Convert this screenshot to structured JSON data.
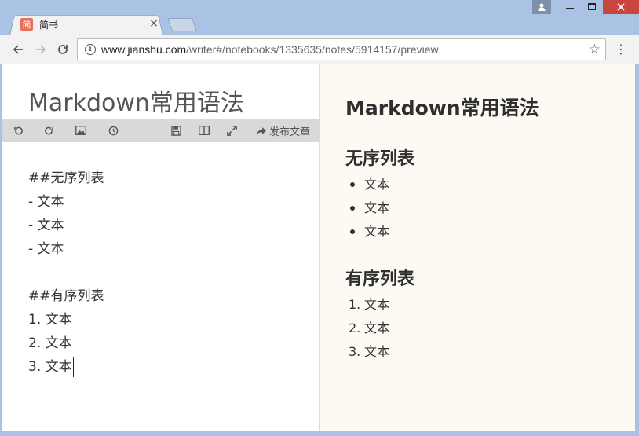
{
  "browser": {
    "tab": {
      "favicon": "简",
      "title": "简书",
      "close": "×"
    },
    "url": {
      "host": "www.jianshu.com",
      "path": "/writer#/notebooks/1335635/notes/5914157/preview"
    },
    "icons": {
      "back": "back-arrow-icon",
      "forward": "forward-arrow-icon",
      "reload": "reload-icon",
      "info": "info-icon",
      "star": "star-icon",
      "menu": "kebab-menu-icon"
    }
  },
  "editor": {
    "title": "Markdown常用语法",
    "toolbar": {
      "undo": "undo-icon",
      "redo": "redo-icon",
      "image": "image-icon",
      "history": "history-clock-icon",
      "save": "save-icon",
      "split": "split-view-icon",
      "fullscreen": "fullscreen-icon",
      "publish_label": "发布文章"
    },
    "lines": [
      "##无序列表",
      "- 文本",
      "- 文本",
      "- 文本",
      "",
      "##有序列表",
      "1. 文本",
      "2. 文本",
      "3. 文本"
    ]
  },
  "preview": {
    "title": "Markdown常用语法",
    "sections": [
      {
        "heading": "无序列表",
        "items": [
          "文本",
          "文本",
          "文本"
        ]
      },
      {
        "heading": "有序列表",
        "items": [
          "文本",
          "文本",
          "文本"
        ],
        "numbers": [
          "1.",
          "2.",
          "3."
        ]
      }
    ]
  },
  "colors": {
    "accent": "#ea6f5a",
    "frame": "#aac3e4",
    "preview_bg": "#fcfaf2",
    "close_button": "#c9463d"
  }
}
